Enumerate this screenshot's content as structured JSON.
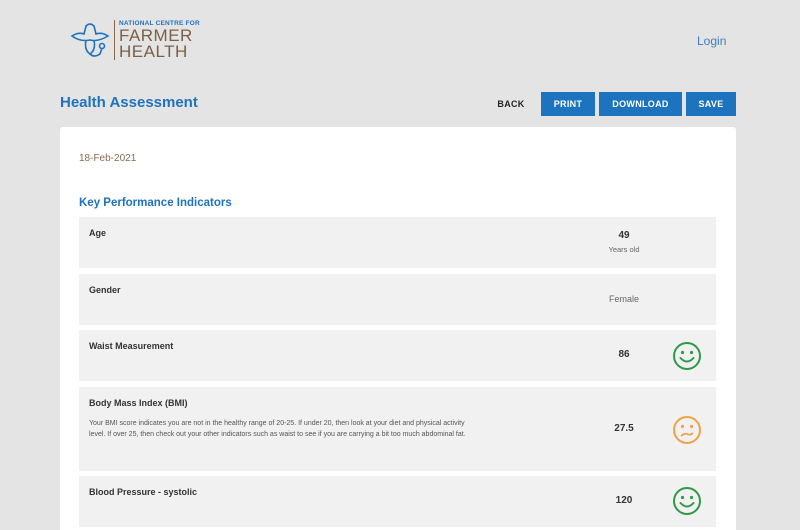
{
  "header": {
    "logo": {
      "line1": "NATIONAL CENTRE FOR",
      "line2": "FARMER",
      "line3": "HEALTH",
      "icon": "farmer-hat-stethoscope-icon"
    },
    "login_label": "Login"
  },
  "toolbar": {
    "title": "Health Assessment",
    "back_label": "BACK",
    "print_label": "PRINT",
    "download_label": "DOWNLOAD",
    "save_label": "SAVE"
  },
  "assessment": {
    "date": "18-Feb-2021",
    "section_title": "Key Performance Indicators",
    "items": [
      {
        "label": "Age",
        "value": "49",
        "unit": "Years old"
      },
      {
        "label": "Gender",
        "value": "Female"
      },
      {
        "label": "Waist Measurement",
        "value": "86",
        "status_icon": "happy-face-icon",
        "status_color": "#2e9a48"
      },
      {
        "label": "Body Mass Index (BMI)",
        "description": "Your BMI score indicates you are not in the healthy range of 20-25. If under 20, then look at your diet and physical activity level. If over 25, then check out your other indicators such as waist to see if you are carrying a bit too much abdominal fat.",
        "value": "27.5",
        "status_icon": "concerned-face-icon",
        "status_color": "#f0a245"
      },
      {
        "label": "Blood Pressure - systolic",
        "value": "120",
        "status_icon": "happy-face-icon",
        "status_color": "#2e9a48"
      }
    ]
  },
  "colors": {
    "brand_blue": "#1e73be",
    "brand_brown": "#8a6a4e",
    "good": "#2e9a48",
    "warning": "#f0a245"
  }
}
